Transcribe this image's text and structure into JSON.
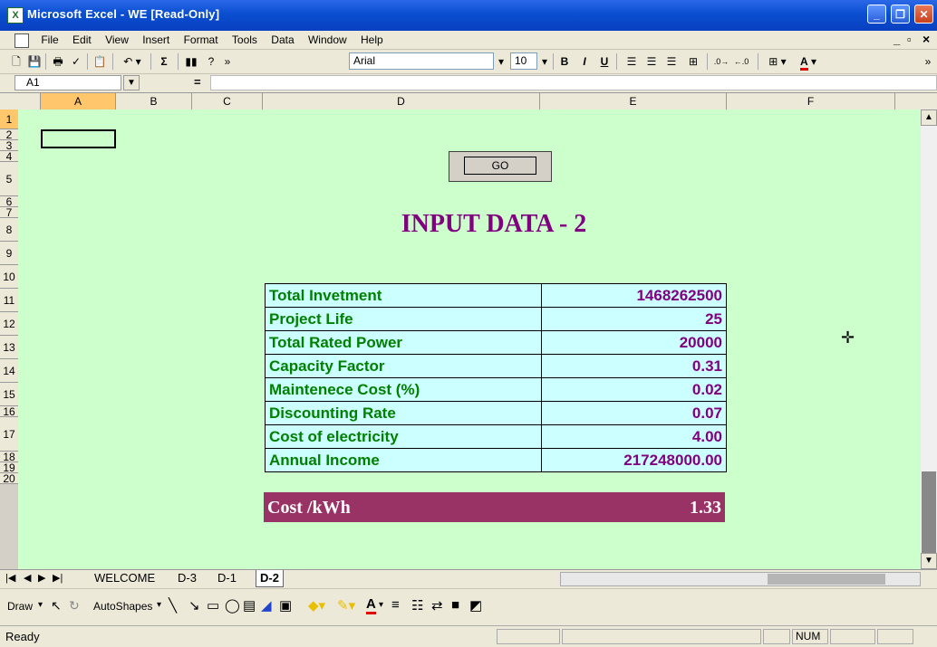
{
  "window": {
    "title": "Microsoft Excel - WE  [Read-Only]",
    "icon": "excel-icon",
    "controls": [
      "minimize",
      "restore",
      "close"
    ]
  },
  "menu": {
    "items": [
      "File",
      "Edit",
      "View",
      "Insert",
      "Format",
      "Tools",
      "Data",
      "Window",
      "Help"
    ],
    "doc_controls": [
      "_",
      "▫",
      "×"
    ]
  },
  "toolbar": {
    "font_name": "Arial",
    "font_size": "10",
    "icons": [
      "new-icon",
      "save-icon",
      "print-icon",
      "spelling-icon",
      "paste-icon",
      "undo-icon",
      "autosum-icon",
      "chart-wizard-icon",
      "help-icon",
      "bold-icon",
      "italic-icon",
      "underline-icon",
      "align-left-icon",
      "center-icon",
      "align-right-icon",
      "merge-center-icon",
      "increase-decimal-icon",
      "decrease-decimal-icon",
      "borders-icon",
      "font-color-icon"
    ]
  },
  "formula_bar": {
    "name_box": "A1",
    "equals": "=",
    "formula": ""
  },
  "columns": [
    "A",
    "B",
    "C",
    "D",
    "E",
    "F"
  ],
  "rows": [
    "1",
    "2",
    "3",
    "4",
    "5",
    "6",
    "7",
    "8",
    "9",
    "10",
    "11",
    "12",
    "13",
    "14",
    "15",
    "16",
    "17",
    "18",
    "19",
    "20"
  ],
  "sheet": {
    "go_button": "GO",
    "title": "INPUT DATA - 2",
    "table": [
      {
        "label": "Total Invetment",
        "value": "1468262500"
      },
      {
        "label": "Project Life",
        "value": "25"
      },
      {
        "label": "Total Rated Power",
        "value": "20000"
      },
      {
        "label": "Capacity Factor",
        "value": "0.31"
      },
      {
        "label": "Maintenece Cost (%)",
        "value": "0.02"
      },
      {
        "label": "Discounting Rate",
        "value": "0.07"
      },
      {
        "label": "Cost of electricity",
        "value": "4.00"
      },
      {
        "label": "Annual Income",
        "value": "217248000.00"
      }
    ],
    "cost_label": "Cost /kWh",
    "cost_value": "1.33"
  },
  "tabs": [
    "WELCOME",
    "D-3",
    "D-1",
    "D-2"
  ],
  "active_tab": "D-2",
  "draw_toolbar": {
    "draw": "Draw",
    "autoshapes": "AutoShapes"
  },
  "status": {
    "ready": "Ready",
    "num": "NUM"
  }
}
